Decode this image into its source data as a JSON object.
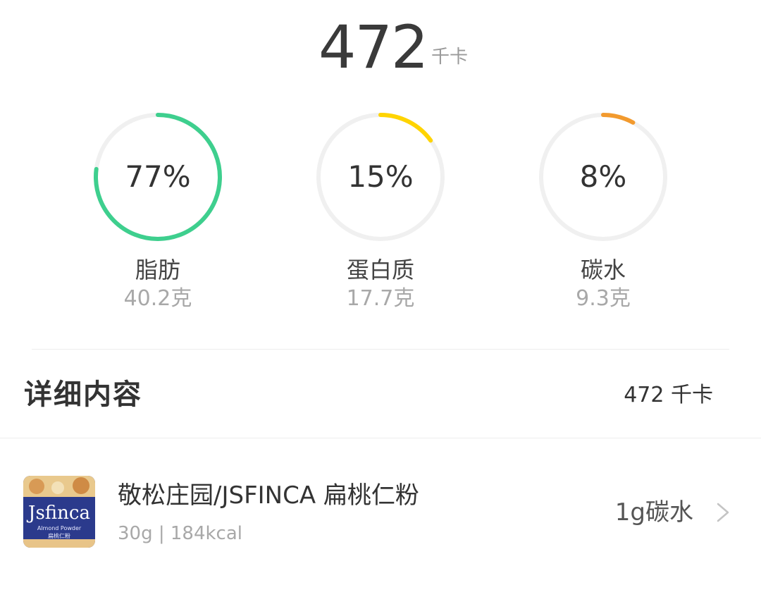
{
  "summary": {
    "calories_value": "472",
    "calories_unit": "千卡"
  },
  "macros": [
    {
      "percent_label": "77%",
      "percent": 77,
      "name": "脂肪",
      "grams": "40.2克",
      "color": "#3ecf8e"
    },
    {
      "percent_label": "15%",
      "percent": 15,
      "name": "蛋白质",
      "grams": "17.7克",
      "color": "#ffd400"
    },
    {
      "percent_label": "8%",
      "percent": 8,
      "name": "碳水",
      "grams": "9.3克",
      "color": "#f29a2e"
    }
  ],
  "detail": {
    "title": "详细内容",
    "total": "472 千卡"
  },
  "foods": [
    {
      "name": "敬松庄园/JSFINCA 扁桃仁粉",
      "meta": "30g | 184kcal",
      "right_value": "1g碳水",
      "image": {
        "brand": "Jsfinca",
        "subtitle": "Almond Powder",
        "subtitle_cn": "扁桃仁粉"
      },
      "icon": "chevron-right-icon"
    }
  ],
  "colors": {
    "ring_track": "#f0f0f0"
  }
}
